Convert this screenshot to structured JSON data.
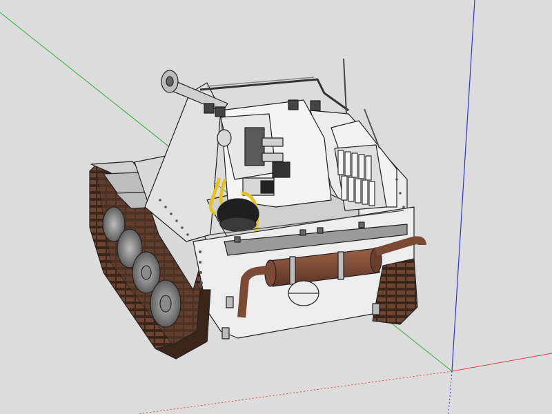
{
  "scene": {
    "background": "#dcdcdc",
    "axis_colors": {
      "x_red": "#e04040",
      "y_green": "#2fb02f",
      "z_blue": "#3030e0"
    },
    "model": {
      "subject": "tank-destroyer-3d-model",
      "hull_color": "#e6e6e6",
      "track_color": "#4a2e1f",
      "muffler_color": "#7b4a35",
      "accent_yellow": "#e3c22a"
    }
  }
}
